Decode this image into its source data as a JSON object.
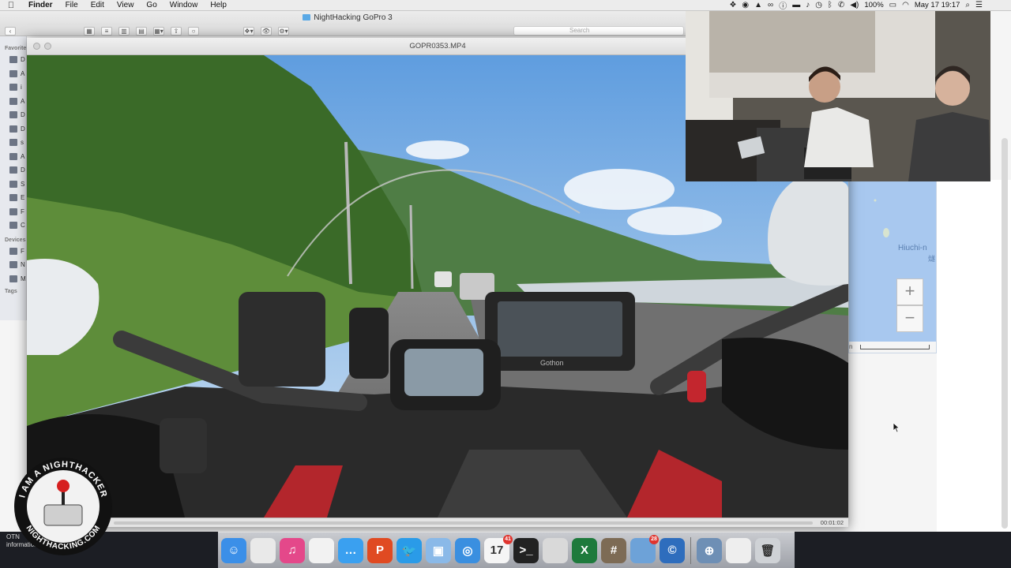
{
  "menubar": {
    "apple": "",
    "app_name": "Finder",
    "menus": [
      "File",
      "Edit",
      "View",
      "Go",
      "Window",
      "Help"
    ],
    "battery": "100%",
    "battery_icon": "battery-icon",
    "clock": "May 17  19:17",
    "status_icons": [
      "dropbox-icon",
      "sync-icon",
      "drive-icon",
      "creative-cloud-icon",
      "info-icon",
      "display-icon",
      "bell-icon",
      "time-machine-icon",
      "bluetooth-icon",
      "phone-icon",
      "volume-icon",
      "wifi-icon",
      "search-icon",
      "list-icon"
    ]
  },
  "finder": {
    "title": "NightHacking GoPro 3",
    "search_placeholder": "Search",
    "sidebar_header_favorites": "Favorites",
    "sidebar_header_devices": "Devices",
    "sidebar_header_tags": "Tags",
    "favorite_items": [
      "D",
      "A",
      "i",
      "A",
      "D",
      "D",
      "s",
      "A",
      "D",
      "S",
      "E",
      "F",
      "C"
    ],
    "device_items": [
      "F",
      "N",
      "M"
    ]
  },
  "video": {
    "title": "GOPR0353.MP4",
    "time": "00:01:02",
    "progress": 0.0,
    "gps_brand": "Gothon"
  },
  "map": {
    "place_label": "Hiuchi-n",
    "place_label2": "燧",
    "zoom_in": "+",
    "zoom_out": "−",
    "scale_letter": "n"
  },
  "dock": {
    "items": [
      {
        "name": "finder-icon",
        "color": "#3b8fe8",
        "glyph": "☺"
      },
      {
        "name": "preview-icon",
        "color": "#e9e9e9",
        "glyph": ""
      },
      {
        "name": "itunes-icon",
        "color": "#e4488a",
        "glyph": "♫"
      },
      {
        "name": "reminders-icon",
        "color": "#f2f2f2",
        "glyph": ""
      },
      {
        "name": "messages-icon",
        "color": "#3aa0f0",
        "glyph": "…"
      },
      {
        "name": "presenter-icon",
        "color": "#e04a22",
        "glyph": "P"
      },
      {
        "name": "twitter-icon",
        "color": "#2a9be8",
        "glyph": "🐦"
      },
      {
        "name": "virtualbox-icon",
        "color": "#8ab9e8",
        "glyph": "▣"
      },
      {
        "name": "safari-icon",
        "color": "#3a8fe0",
        "glyph": "◎"
      },
      {
        "name": "calendar-icon",
        "color": "#f5f5f5",
        "glyph": "17",
        "badge": "41"
      },
      {
        "name": "terminal-icon",
        "color": "#222222",
        "glyph": ">_"
      },
      {
        "name": "image-capture-icon",
        "color": "#d9d9d9",
        "glyph": ""
      },
      {
        "name": "excel-icon",
        "color": "#1e7a3c",
        "glyph": "X"
      },
      {
        "name": "calculator-icon",
        "color": "#7d6b55",
        "glyph": "#"
      },
      {
        "name": "photo-icon",
        "color": "#6da2d8",
        "glyph": "",
        "badge": "28"
      },
      {
        "name": "safari-alt-icon",
        "color": "#2e6dbd",
        "glyph": "©"
      },
      {
        "name": "network-icon",
        "color": "#6e8fb5",
        "glyph": "⊕"
      },
      {
        "name": "documents-icon",
        "color": "#eeeeee",
        "glyph": ""
      },
      {
        "name": "trash-icon",
        "color": "#cfd2d6",
        "glyph": "🗑"
      }
    ]
  },
  "otn": {
    "line1": "OTN",
    "line2": "information"
  },
  "badge": {
    "top_text": "I AM A NIGHTHACKER",
    "bottom_text": "NIGHTHACKING.COM"
  },
  "colors": {
    "sky": "#8bbde8",
    "foliage": "#3f6a2a",
    "road": "#6b6b6b",
    "map_water": "#a8c8ef"
  }
}
